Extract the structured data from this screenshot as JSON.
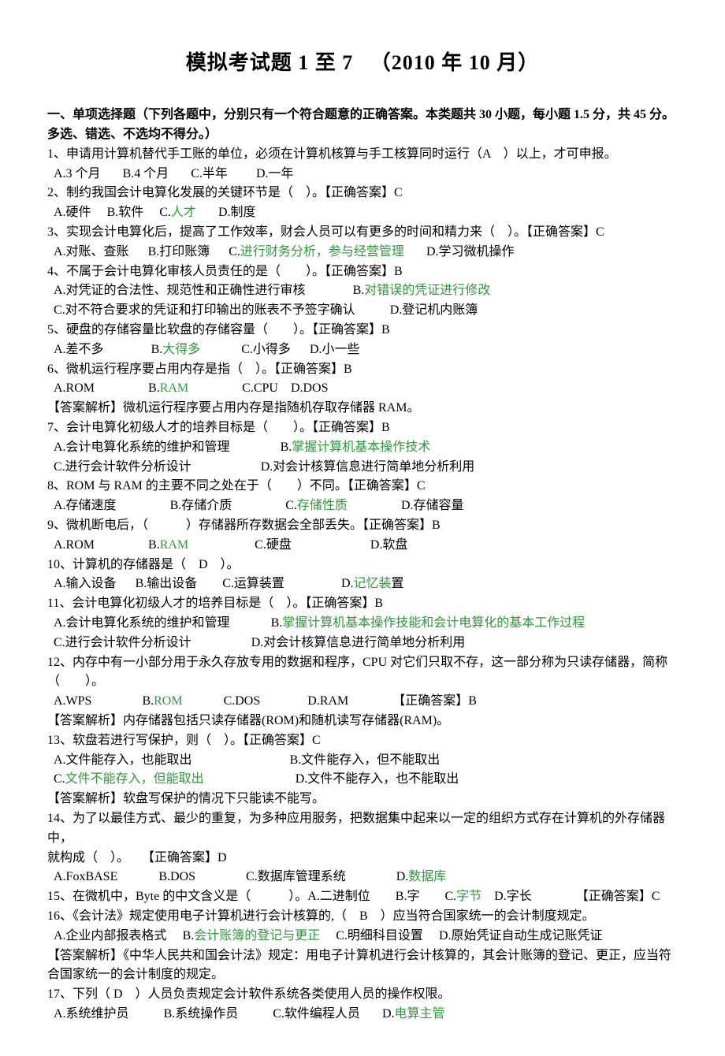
{
  "title": "模拟考试题 1 至 7 　（2010 年 10 月）",
  "sectionHead1": "一、单项选择题（下列各题中，分别只有一个符合题意的正确答案。本类题共 30 小题，每小题 1.5 分，共 45 分。",
  "sectionHead2": "多选、错选、不选均不得分。）",
  "q1": {
    "text": "1、申请用计算机替代手工账的单位，必须在计算机核算与手工核算同时运行（A　）以上，才可申报。",
    "a": "A.3 个月",
    "b": "B.4 个月",
    "c": "C.半年",
    "d": "D.一年"
  },
  "q2": {
    "text": "2、制约我国会计电算化发展的关键环节是（　）。【正确答案】C",
    "a": "A.硬件",
    "b": "B.软件",
    "cPrefix": "C.",
    "cAns": "人才",
    "d": "D.制度"
  },
  "q3": {
    "text": "3、实现会计电算化后，提高了工作效率，财会人员可以有更多的时间和精力来（　）。【正确答案】C",
    "a": "A.对账、查账",
    "b": "B.打印账簿",
    "cPrefix": "C.",
    "cAns": "进行财务分析，参与经营管理",
    "d": "D.学习微机操作"
  },
  "q4": {
    "text": "4、不属于会计电算化审核人员责任的是（　　）。【正确答案】B",
    "a": "A.对凭证的合法性、规范性和正确性进行审核",
    "bPrefix": "B.",
    "bAns": "对错误的凭证进行修改",
    "c": "C.对不符合要求的凭证和打印输出的账表不予签字确认",
    "d": "D.登记机内账簿"
  },
  "q5": {
    "text": "5、硬盘的存储容量比软盘的存储容量（　　）。【正确答案】B",
    "a": "A.差不多",
    "bPrefix": "B.",
    "bAns": "大得多",
    "c": "C.小得多",
    "d": "D.小一些"
  },
  "q6": {
    "text": "6、微机运行程序要占用内存是指（　）。【正确答案】B",
    "a": "A.ROM",
    "bPrefix": "B.",
    "bAns": "RAM",
    "c": "C.CPU",
    "d": "D.DOS",
    "analysis": "【答案解析】微机运行程序要占用内存是指随机存取存储器 RAM。"
  },
  "q7": {
    "text": "7、会计电算化初级人才的培养目标是（　　）。【正确答案】B",
    "a": "A.会计电算化系统的维护和管理",
    "bPrefix": "B.",
    "bAns": "掌握计算机基本操作技术",
    "c": "C.进行会计软件分析设计",
    "d": "D.对会计核算信息进行简单地分析利用"
  },
  "q8": {
    "text": "8、ROM 与 RAM 的主要不同之处在于（　　）不同。【正确答案】C",
    "a": "A.存储速度",
    "b": "B.存储介质",
    "cPrefix": "C.",
    "cAns": "存储性质",
    "d": "D.存储容量"
  },
  "q9": {
    "text": "9、微机断电后，（　　　）存储器所存数据会全部丢失。【正确答案】B",
    "a": "A.ROM",
    "bPrefix": "B.",
    "bAns": "RAM",
    "c": "C.硬盘",
    "d": "D.软盘"
  },
  "q10": {
    "text": "10、计算机的存储器是（　D　）。",
    "a": "A.输入设备",
    "b": "B.输出设备",
    "c": "C.运算装置",
    "dPrefix": "D.",
    "dAns": "记忆装",
    "dSuffix": "置"
  },
  "q11": {
    "text": "11、会计电算化初级人才的培养目标是（　）。【正确答案】B",
    "a": "A.会计电算化系统的维护和管理",
    "bPrefix": "B.",
    "bAns": "掌握计算机基本操作技能和会计电算化的基本工作过程",
    "c": "C.进行会计软件分析设计",
    "d": "D.对会计核算信息进行简单地分析利用"
  },
  "q12": {
    "line1": "12、内存中有一小部分用于永久存放专用的数据和程序，CPU 对它们只取不存，这一部分称为只读存储器，简称",
    "line2": "（　　）。",
    "a": "A.WPS",
    "bPrefix": "B.",
    "bAns": "ROM",
    "c": "C.DOS",
    "d": "D.RAM",
    "answer": "【正确答案】B",
    "analysis": "【答案解析】内存储器包括只读存储器(ROM)和随机读写存储器(RAM)。"
  },
  "q13": {
    "text": "13、软盘若进行写保护，则（　）。【正确答案】C",
    "a": "A.文件能存入，也能取出",
    "b": "B.文件能存入，但不能取出",
    "cPrefix": "C.",
    "cAns": "文件不能存入，但能取出",
    "d": "D.文件不能存入，也不能取出",
    "analysis": "【答案解析】软盘写保护的情况下只能读不能写。"
  },
  "q14": {
    "line1": "14、为了以最佳方式、最少的重复，为多种应用服务，把数据集中起来以一定的组织方式存在计算机的外存储器中，",
    "line2": "就构成（　）。　　【正确答案】D",
    "a": "A.FoxBASE",
    "b": "B.DOS",
    "c": "C.数据库管理系统",
    "dPrefix": "D.",
    "dAns": "数据库"
  },
  "q15": {
    "pre": "15、在微机中，Byte 的中文含义是（　　　）。A.二进制位　　B.字　　C.",
    "cAns": "字节",
    "post": "　D.字长　　　　【正确答案】C"
  },
  "q16": {
    "text": "16、《会计法》规定使用电子计算机进行会计核算的,（　B　）应当符合国家统一的会计制度规定。",
    "a": "A.企业内部报表格式",
    "bPrefix": "B.",
    "bAns": "会计账簿的登记与更正",
    "c": "C.明细科目设置",
    "d": "D.原始凭证自动生成记账凭证",
    "analysis1": "【答案解析】《中华人民共和国会计法》规定：用电子计算机进行会计核算的，其会计账簿的登记、更正，应当符",
    "analysis2": "合国家统一的会计制度的规定。"
  },
  "q17": {
    "text": "17、下列（ D　）人员负责规定会计软件系统各类使用人员的操作权限。",
    "a": "A.系统维护员",
    "b": "B.系统操作员",
    "c": "C.软件编程人员",
    "dPrefix": "D.",
    "dAns": "电算主管"
  }
}
